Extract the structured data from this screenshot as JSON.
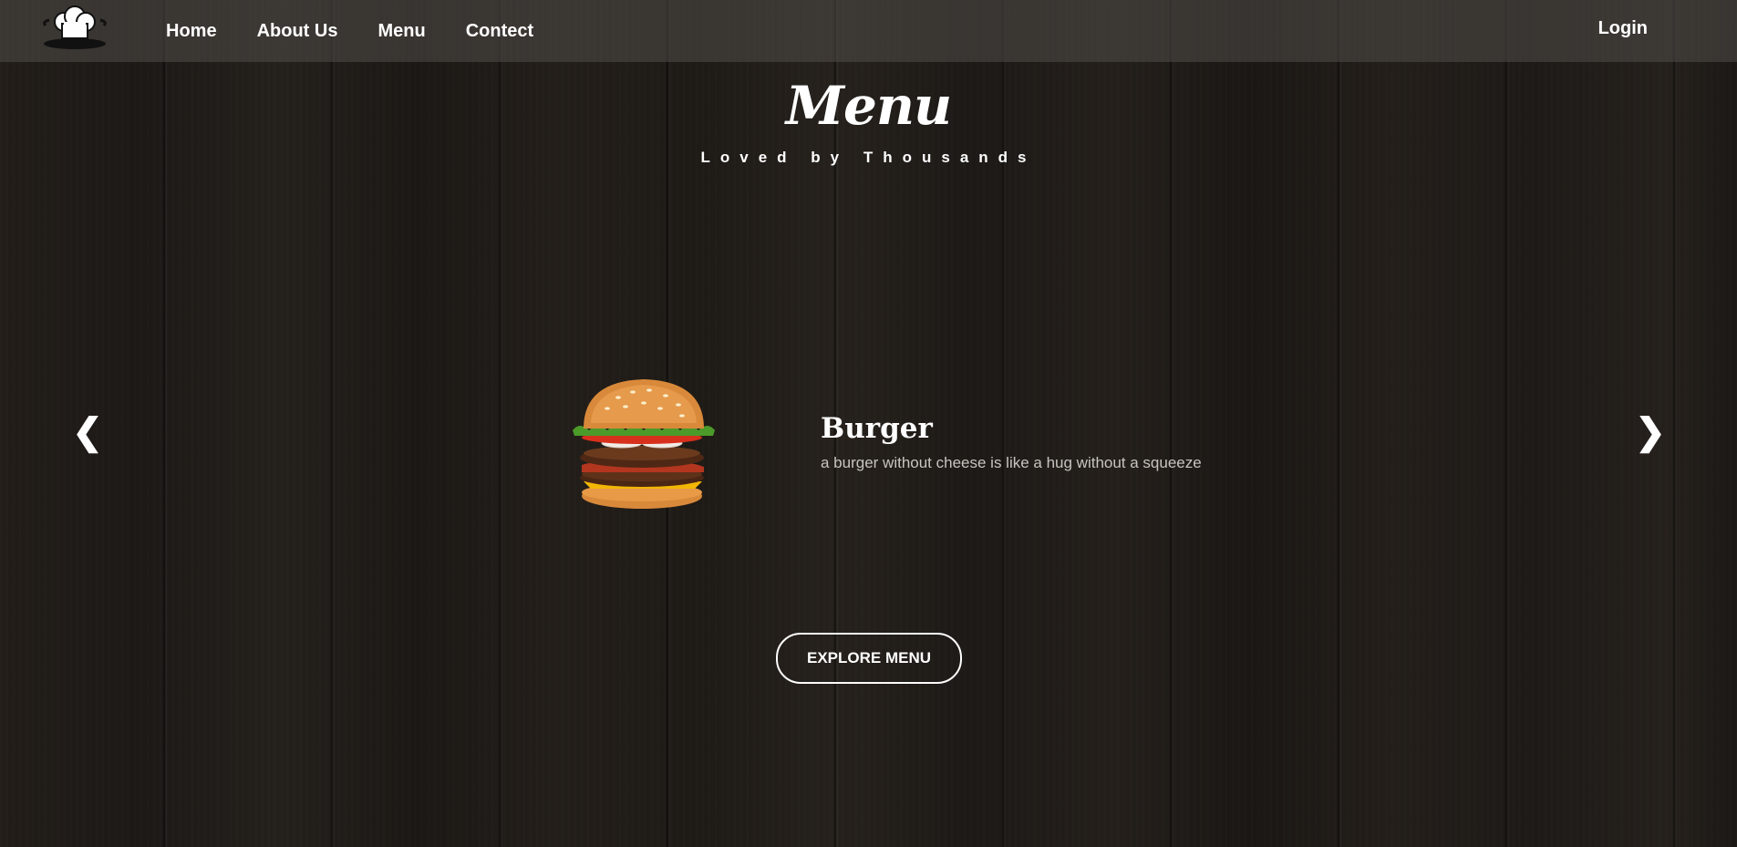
{
  "navbar": {
    "logo_icon": "chef-hat-icon",
    "links": [
      {
        "label": "Home"
      },
      {
        "label": "About Us"
      },
      {
        "label": "Menu"
      },
      {
        "label": "Contect"
      }
    ],
    "login_label": "Login"
  },
  "hero": {
    "title": "Menu",
    "subtitle": "Loved by Thousands"
  },
  "slider": {
    "prev_icon": "chevron-left-icon",
    "next_icon": "chevron-right-icon",
    "prev_glyph": "❮",
    "next_glyph": "❯",
    "current_item": {
      "image_icon": "burger-icon",
      "title": "Burger",
      "description": "a burger without cheese is like a hug without a squeeze"
    }
  },
  "cta": {
    "label": "EXPLORE MENU"
  },
  "colors": {
    "text": "#ffffff",
    "muted_text": "#c8c4c0",
    "navbar_bg": "#504c48",
    "background": "#1e1a17"
  }
}
